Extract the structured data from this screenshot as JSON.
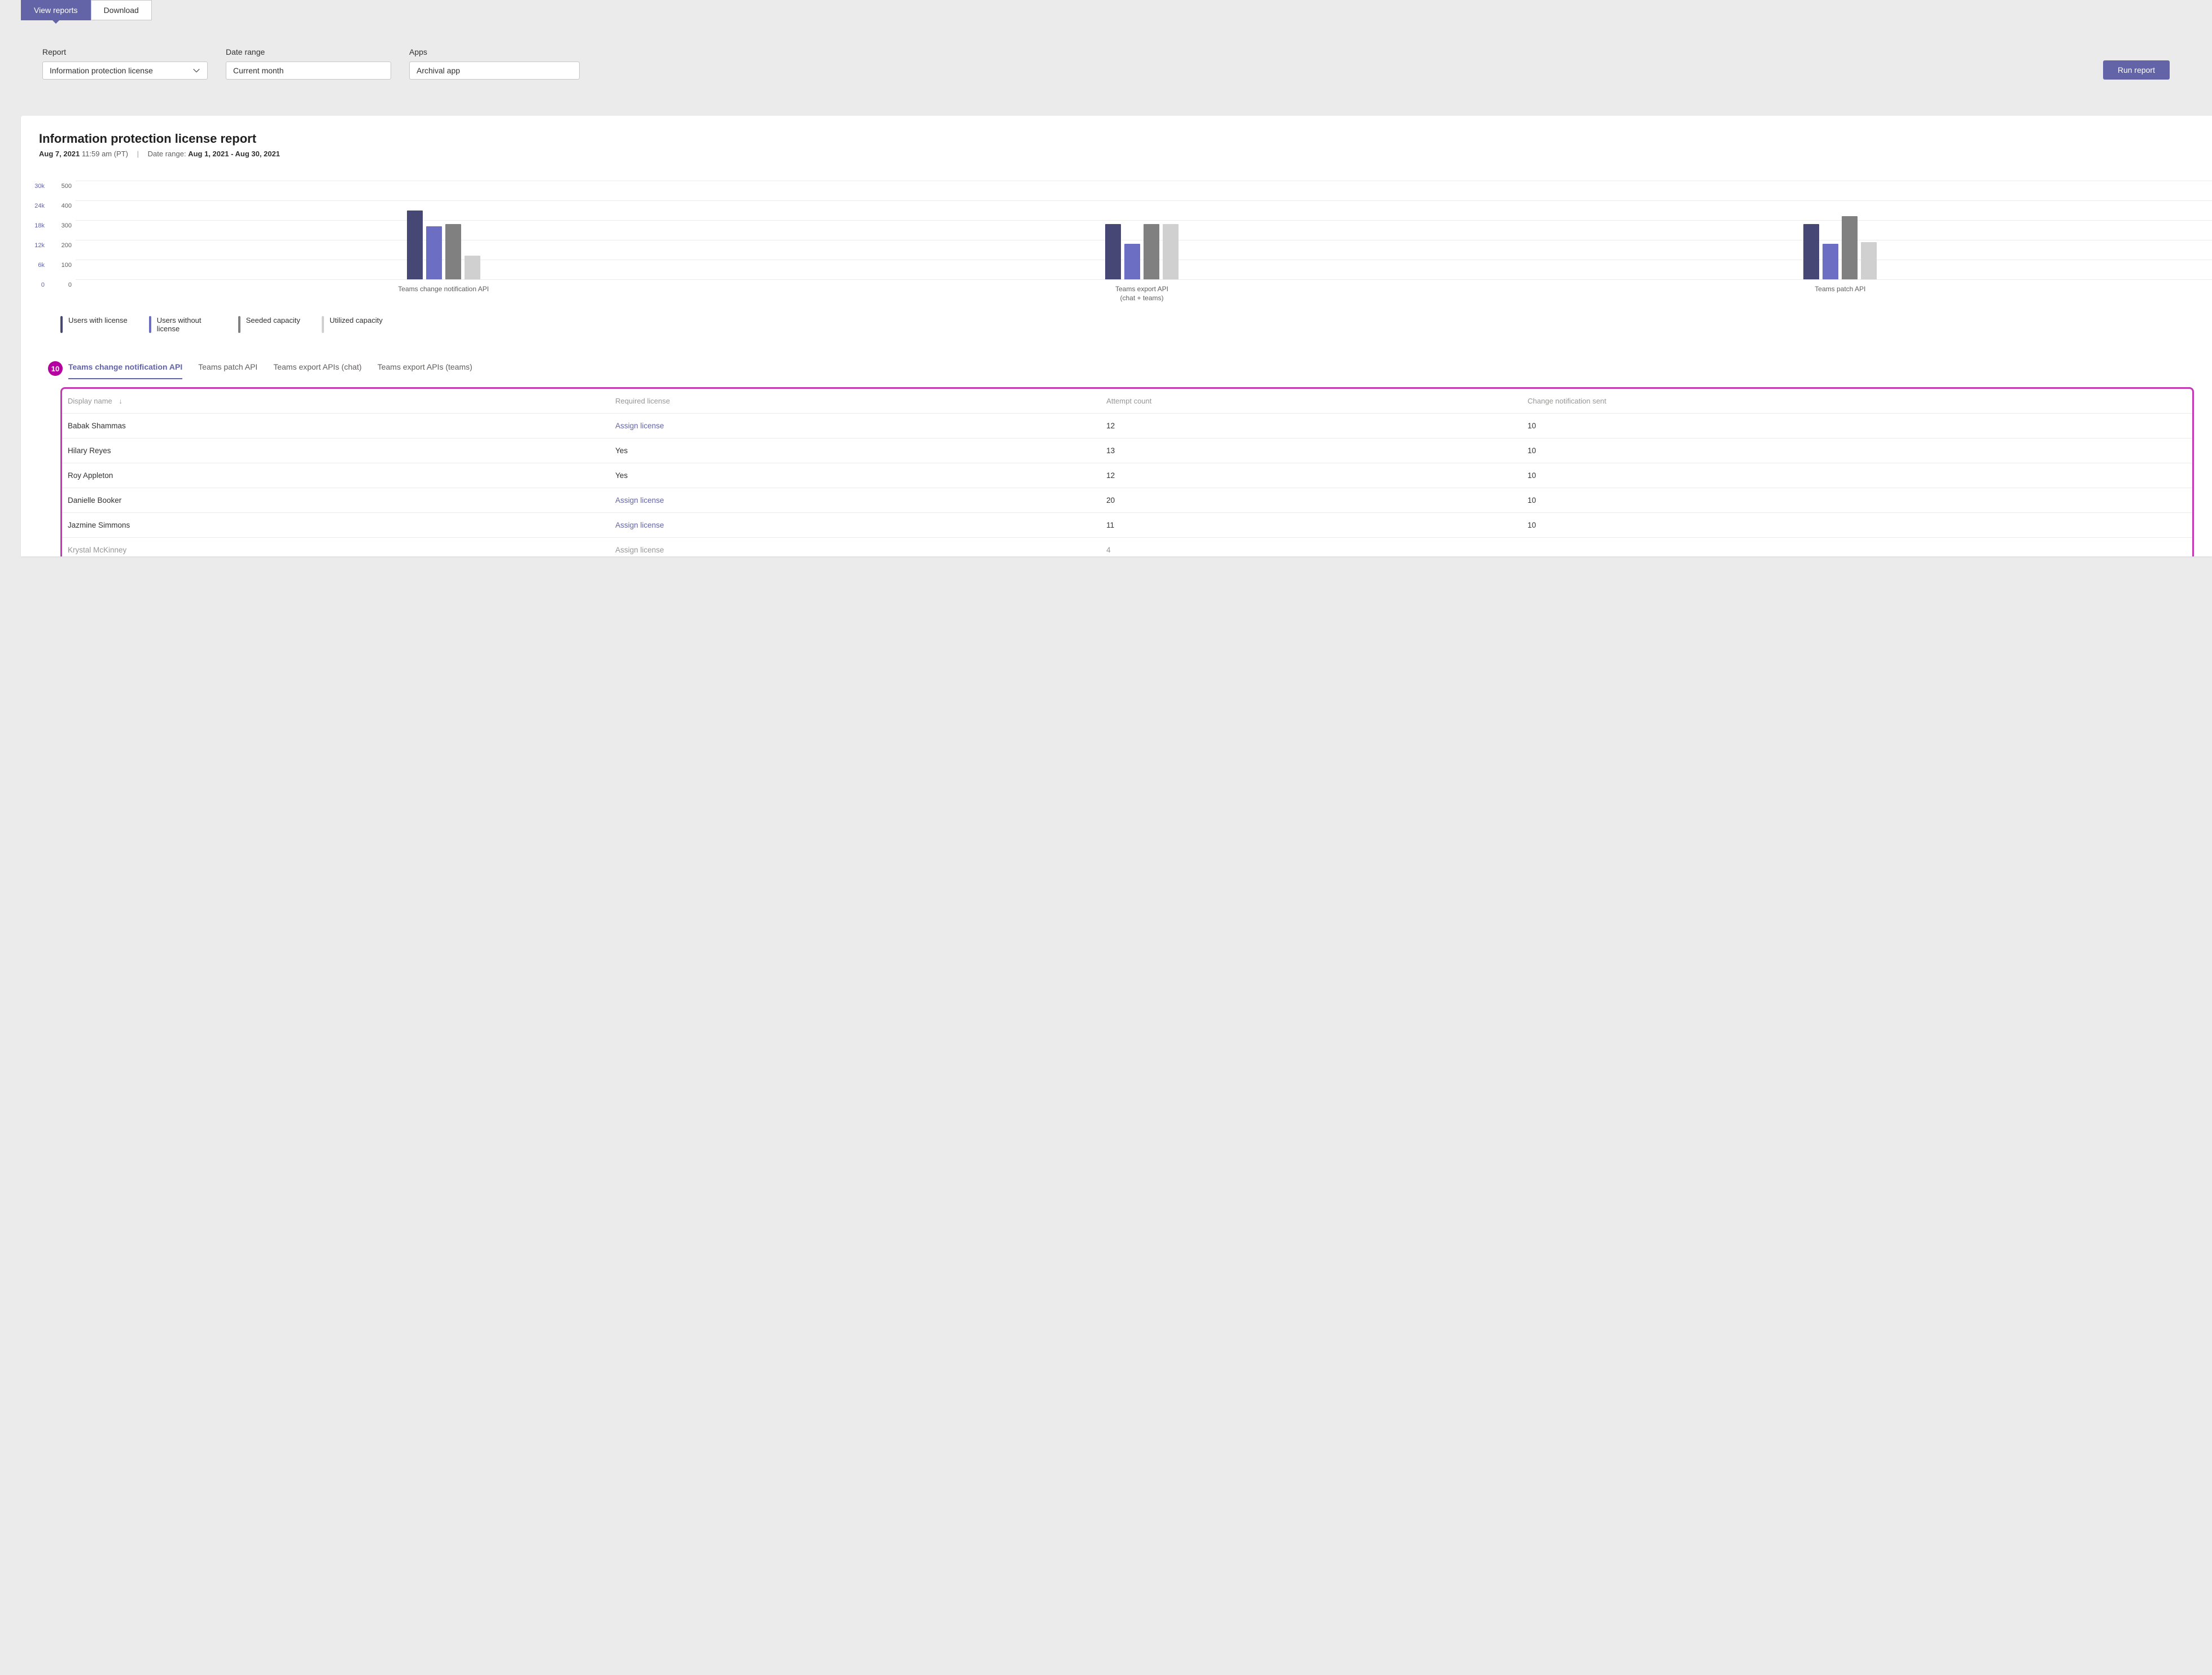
{
  "top_tabs": {
    "view_reports": "View reports",
    "download": "Download"
  },
  "filters": {
    "report_label": "Report",
    "report_value": "Information protection license",
    "date_label": "Date range",
    "date_value": "Current month",
    "apps_label": "Apps",
    "apps_value": "Archival app",
    "run_label": "Run report"
  },
  "report": {
    "title": "Information protection license report",
    "timestamp_date": "Aug 7, 2021",
    "timestamp_time": "11:59 am (PT)",
    "daterange_prefix": "Date range:",
    "daterange_value": "Aug 1, 2021 - Aug 30, 2021"
  },
  "chart_data": {
    "type": "bar",
    "left_y_ticks": [
      "30k",
      "24k",
      "18k",
      "12k",
      "6k",
      "0"
    ],
    "right_y_ticks": [
      "500",
      "400",
      "300",
      "200",
      "100",
      "0"
    ],
    "ylim": [
      0,
      500
    ],
    "categories": [
      "Teams change notification API",
      "Teams export API\n(chat + teams)",
      "Teams patch API"
    ],
    "series": [
      {
        "name": "Users with license",
        "values": [
          350,
          280,
          280
        ]
      },
      {
        "name": "Users without license",
        "values": [
          270,
          180,
          180
        ]
      },
      {
        "name": "Seeded capacity",
        "values": [
          280,
          280,
          320
        ]
      },
      {
        "name": "Utilized capacity",
        "values": [
          120,
          280,
          190
        ]
      }
    ]
  },
  "legend": [
    "Users with license",
    "Users without license",
    "Seeded capacity",
    "Utilized capacity"
  ],
  "annotation_badge": "10",
  "sub_tabs": [
    "Teams change notification API",
    "Teams patch API",
    "Teams export APIs (chat)",
    "Teams export APIs (teams)"
  ],
  "table": {
    "headers": [
      "Display name",
      "Required license",
      "Attempt count",
      "Change notification sent"
    ],
    "rows": [
      {
        "name": "Babak Shammas",
        "license": "Assign license",
        "license_link": true,
        "attempts": "12",
        "sent": "10"
      },
      {
        "name": "Hilary Reyes",
        "license": "Yes",
        "license_link": false,
        "attempts": "13",
        "sent": "10"
      },
      {
        "name": "Roy Appleton",
        "license": "Yes",
        "license_link": false,
        "attempts": "12",
        "sent": "10"
      },
      {
        "name": "Danielle Booker",
        "license": "Assign license",
        "license_link": true,
        "attempts": "20",
        "sent": "10"
      },
      {
        "name": "Jazmine Simmons",
        "license": "Assign license",
        "license_link": true,
        "attempts": "11",
        "sent": "10"
      },
      {
        "name": "Krystal McKinney",
        "license": "Assign license",
        "license_link": true,
        "attempts": "4",
        "sent": ""
      }
    ]
  }
}
